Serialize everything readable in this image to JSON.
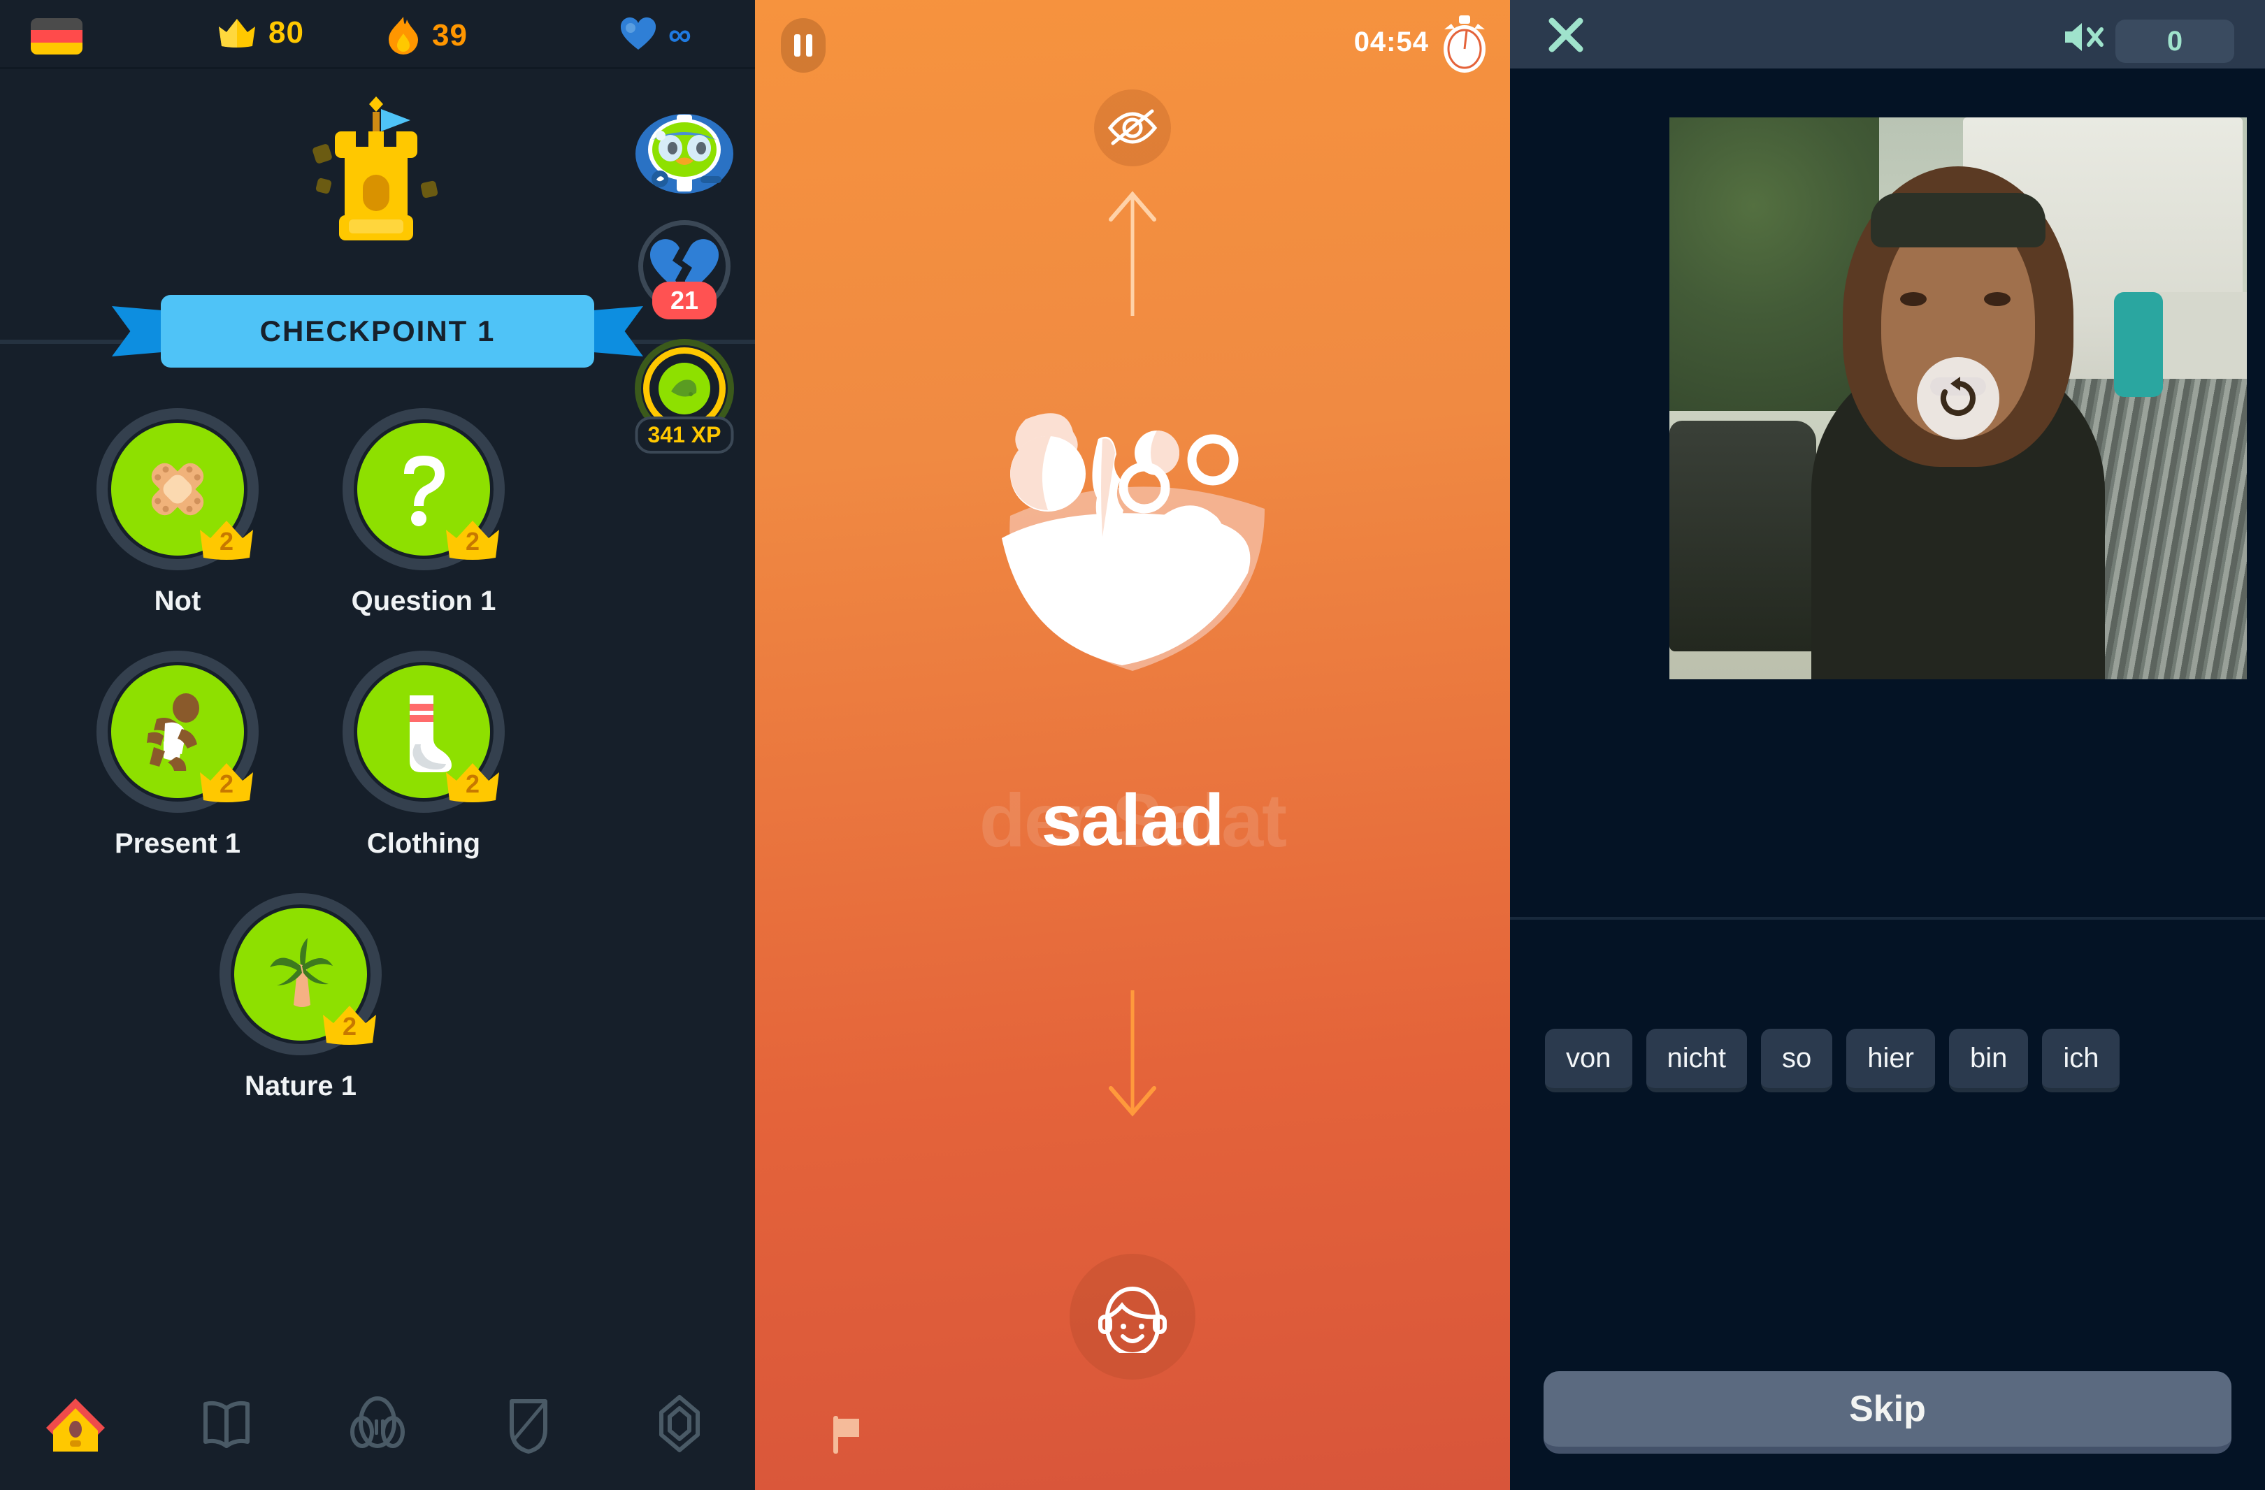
{
  "left_panel": {
    "topbar": {
      "language_flag": "germany-flag",
      "crowns_icon": "crown-icon",
      "crowns": "80",
      "streak_icon": "flame-icon",
      "streak": "39",
      "hearts_icon": "heart-icon",
      "hearts": "∞"
    },
    "checkpoint": {
      "icon": "castle-icon",
      "label": "CHECKPOINT 1"
    },
    "rail": {
      "mascot_icon": "duo-owl-avatar",
      "hearts_refill": {
        "icon": "broken-heart-icon",
        "badge": "21"
      },
      "xp_chest": {
        "icon": "leaf-chest-icon",
        "label": "341 XP"
      }
    },
    "skills": [
      {
        "name": "Not",
        "icon": "bandage-icon",
        "crown_level": "2"
      },
      {
        "name": "Question 1",
        "icon": "question-mark-icon",
        "crown_level": "2"
      },
      {
        "name": "Present 1",
        "icon": "running-person-icon",
        "crown_level": "2"
      },
      {
        "name": "Clothing",
        "icon": "sock-icon",
        "crown_level": "2"
      },
      {
        "name": "Nature 1",
        "icon": "palm-tree-icon",
        "crown_level": "2"
      }
    ],
    "bottom_nav": [
      {
        "name": "home",
        "icon": "birdhouse-icon",
        "active": true
      },
      {
        "name": "stories",
        "icon": "open-book-icon",
        "active": false
      },
      {
        "name": "practice",
        "icon": "dumbbell-icon",
        "active": false
      },
      {
        "name": "leagues",
        "icon": "shield-icon",
        "active": false
      },
      {
        "name": "shop",
        "icon": "gem-icon",
        "active": false
      }
    ]
  },
  "center_panel": {
    "pause_icon": "pause-icon",
    "timer": "04:54",
    "timer_icon": "stopwatch-icon",
    "hide_icon": "eye-off-icon",
    "arrow_up_icon": "arrow-up-icon",
    "illustration_icon": "salad-bowl-icon",
    "word": "salad",
    "word_ghost": "der Salat",
    "arrow_down_icon": "arrow-down-icon",
    "person_icon": "person-face-icon",
    "report_icon": "flag-icon"
  },
  "right_panel": {
    "close_icon": "close-x-icon",
    "mute_icon": "speaker-mute-icon",
    "score": "0",
    "video": {
      "replay_icon": "replay-icon"
    },
    "word_bank": [
      "von",
      "nicht",
      "so",
      "hier",
      "bin",
      "ich"
    ],
    "skip_label": "Skip"
  },
  "colors": {
    "dark_bg": "#161f2a",
    "card_orange": "#e4633a",
    "duo_green": "#8ee000",
    "crown_gold": "#ffc800",
    "streak_orange": "#ff9600",
    "heart_blue": "#1f7ae0",
    "banner_blue": "#4fc3f7",
    "mint": "#9fe3cc",
    "right_bg": "#041325"
  }
}
